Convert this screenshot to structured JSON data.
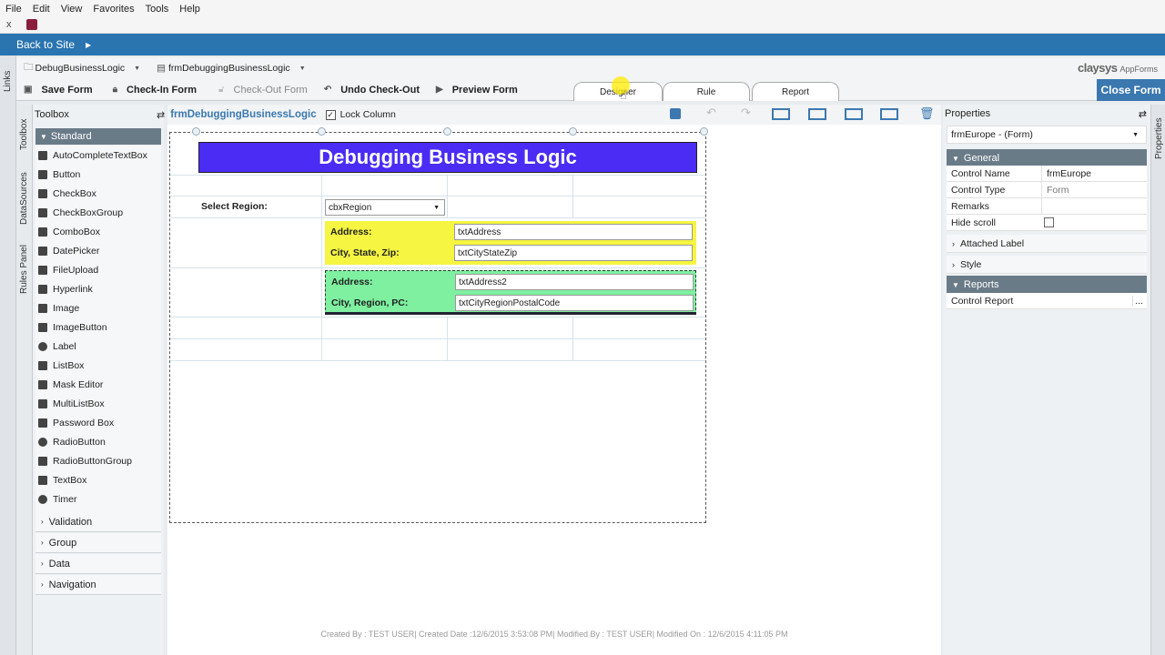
{
  "menu": [
    "File",
    "Edit",
    "View",
    "Favorites",
    "Tools",
    "Help"
  ],
  "tab": {
    "close": "x"
  },
  "back_to_site": "Back to Site",
  "side_tabs": {
    "links": "Links",
    "toolbox": "Toolbox",
    "datasources": "DataSources",
    "rules": "Rules Panel",
    "properties": "Properties"
  },
  "selectors": {
    "project": "DebugBusinessLogic",
    "form": "frmDebuggingBusinessLogic"
  },
  "brand": {
    "name": "claysys",
    "product": "AppForms"
  },
  "toolbar": {
    "save": "Save Form",
    "checkin": "Check-In Form",
    "checkout": "Check-Out Form",
    "undo": "Undo Check-Out",
    "preview": "Preview Form",
    "close": "Close Form"
  },
  "design_tabs": [
    "Designer",
    "Rule",
    "Report"
  ],
  "toolbox": {
    "title": "Toolbox",
    "section": "Standard",
    "items": [
      "AutoCompleteTextBox",
      "Button",
      "CheckBox",
      "CheckBoxGroup",
      "ComboBox",
      "DatePicker",
      "FileUpload",
      "Hyperlink",
      "Image",
      "ImageButton",
      "Label",
      "ListBox",
      "Mask Editor",
      "MultiListBox",
      "Password Box",
      "RadioButton",
      "RadioButtonGroup",
      "TextBox",
      "Timer"
    ],
    "groups": [
      "Validation",
      "Group",
      "Data",
      "Navigation"
    ]
  },
  "designer": {
    "form_name": "frmDebuggingBusinessLogic",
    "lock_column": "Lock Column",
    "lock_checked": true
  },
  "form": {
    "title": "Debugging Business Logic",
    "select_region_label": "Select Region:",
    "region_combo": "cbxRegion",
    "panel1": {
      "address_label": "Address:",
      "address_value": "txtAddress",
      "csz_label": "City, State, Zip:",
      "csz_value": "txtCityStateZip",
      "color": "#f5f542"
    },
    "panel2": {
      "address_label": "Address:",
      "address_value": "txtAddress2",
      "crp_label": "City, Region, PC:",
      "crp_value": "txtCityRegionPostalCode",
      "color": "#7ef0a0"
    },
    "title_color": "#4a2cf5"
  },
  "properties": {
    "title": "Properties",
    "selector": "frmEurope - (Form)",
    "general": "General",
    "rows": [
      {
        "name": "Control Name",
        "value": "frmEurope"
      },
      {
        "name": "Control Type",
        "value": "Form"
      },
      {
        "name": "Remarks",
        "value": ""
      },
      {
        "name": "Hide scroll",
        "value": ""
      }
    ],
    "attached_label": "Attached Label",
    "style": "Style",
    "reports": "Reports",
    "control_report": "Control Report",
    "ellipsis": "..."
  },
  "footer": "Created By :  TEST USER|  Created Date :12/6/2015 3:53:08 PM|  Modified By :  TEST USER|  Modified On : 12/6/2015 4:11:05 PM"
}
